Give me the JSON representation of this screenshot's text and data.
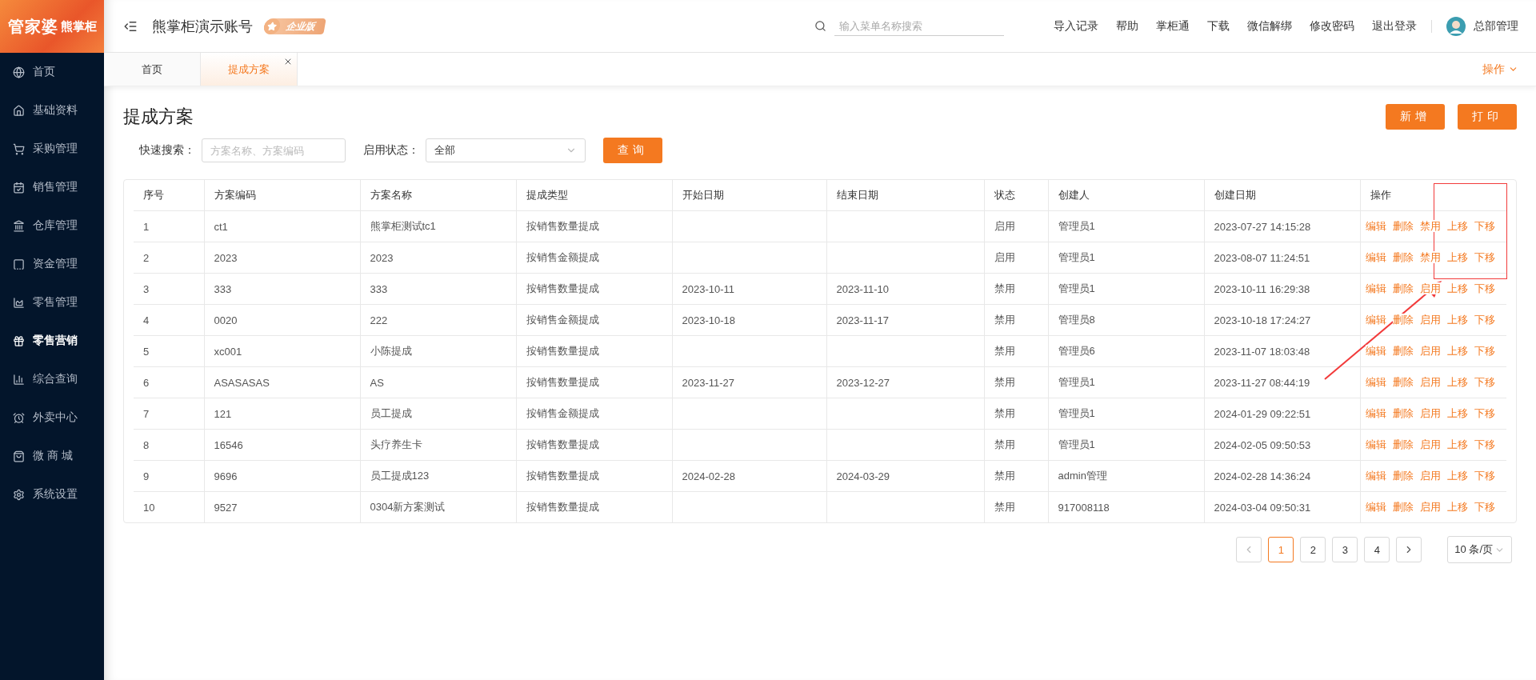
{
  "logo": {
    "brand": "管家婆",
    "product": "熊掌柜"
  },
  "sidebar": {
    "items": [
      {
        "label": "首页",
        "selected": false
      },
      {
        "label": "基础资料",
        "selected": false
      },
      {
        "label": "采购管理",
        "selected": false
      },
      {
        "label": "销售管理",
        "selected": false
      },
      {
        "label": "仓库管理",
        "selected": false
      },
      {
        "label": "资金管理",
        "selected": false
      },
      {
        "label": "零售管理",
        "selected": false
      },
      {
        "label": "零售营销",
        "selected": true
      },
      {
        "label": "综合查询",
        "selected": false
      },
      {
        "label": "外卖中心",
        "selected": false
      },
      {
        "label": "微 商 城",
        "selected": false
      },
      {
        "label": "系统设置",
        "selected": false
      }
    ]
  },
  "header": {
    "account": "熊掌柜演示账号",
    "edition": "企业版",
    "search": {
      "placeholder": "输入菜单名称搜索"
    },
    "links": [
      "导入记录",
      "帮助",
      "掌柜通",
      "下载",
      "微信解绑",
      "修改密码",
      "退出登录"
    ],
    "user": "总部管理"
  },
  "tabs": [
    {
      "label": "首页",
      "selected": false,
      "closable": false
    },
    {
      "label": "提成方案",
      "selected": true,
      "closable": true
    }
  ],
  "tab_menu": "操作",
  "page": {
    "title": "提成方案",
    "buttons": [
      "新增",
      "打印"
    ]
  },
  "filters": {
    "quick_search": {
      "label": "快速搜索：",
      "placeholder": "方案名称、方案编码"
    },
    "status": {
      "label": "启用状态：",
      "value": "全部"
    },
    "query_button": "查询"
  },
  "table": {
    "columns": [
      "序号",
      "方案编码",
      "方案名称",
      "提成类型",
      "开始日期",
      "结束日期",
      "状态",
      "创建人",
      "创建日期",
      "操作"
    ],
    "rows": [
      {
        "cells": [
          "1",
          "ct1",
          "熊掌柜测试tc1",
          "按销售数量提成",
          "",
          "",
          "启用",
          "管理员1",
          "2023-07-27 14:15:28"
        ],
        "actions": [
          "编辑",
          "删除",
          "禁用",
          "上移",
          "下移"
        ]
      },
      {
        "cells": [
          "2",
          "2023",
          "2023",
          "按销售金额提成",
          "",
          "",
          "启用",
          "管理员1",
          "2023-08-07 11:24:51"
        ],
        "actions": [
          "编辑",
          "删除",
          "禁用",
          "上移",
          "下移"
        ]
      },
      {
        "cells": [
          "3",
          "333",
          "333",
          "按销售数量提成",
          "2023-10-11",
          "2023-11-10",
          "禁用",
          "管理员1",
          "2023-10-11 16:29:38"
        ],
        "actions": [
          "编辑",
          "删除",
          "启用",
          "上移",
          "下移"
        ]
      },
      {
        "cells": [
          "4",
          "0020",
          "222",
          "按销售金额提成",
          "2023-10-18",
          "2023-11-17",
          "禁用",
          "管理员8",
          "2023-10-18 17:24:27"
        ],
        "actions": [
          "编辑",
          "删除",
          "启用",
          "上移",
          "下移"
        ]
      },
      {
        "cells": [
          "5",
          "xc001",
          "小陈提成",
          "按销售数量提成",
          "",
          "",
          "禁用",
          "管理员6",
          "2023-11-07 18:03:48"
        ],
        "actions": [
          "编辑",
          "删除",
          "启用",
          "上移",
          "下移"
        ]
      },
      {
        "cells": [
          "6",
          "ASASASAS",
          "AS",
          "按销售数量提成",
          "2023-11-27",
          "2023-12-27",
          "禁用",
          "管理员1",
          "2023-11-27 08:44:19"
        ],
        "actions": [
          "编辑",
          "删除",
          "启用",
          "上移",
          "下移"
        ]
      },
      {
        "cells": [
          "7",
          "121",
          "员工提成",
          "按销售金额提成",
          "",
          "",
          "禁用",
          "管理员1",
          "2024-01-29 09:22:51"
        ],
        "actions": [
          "编辑",
          "删除",
          "启用",
          "上移",
          "下移"
        ]
      },
      {
        "cells": [
          "8",
          "16546",
          "头疗养生卡",
          "按销售数量提成",
          "",
          "",
          "禁用",
          "管理员1",
          "2024-02-05 09:50:53"
        ],
        "actions": [
          "编辑",
          "删除",
          "启用",
          "上移",
          "下移"
        ]
      },
      {
        "cells": [
          "9",
          "9696",
          "员工提成123",
          "按销售数量提成",
          "2024-02-28",
          "2024-03-29",
          "禁用",
          "admin管理",
          "2024-02-28 14:36:24"
        ],
        "actions": [
          "编辑",
          "删除",
          "启用",
          "上移",
          "下移"
        ]
      },
      {
        "cells": [
          "10",
          "9527",
          "0304新方案测试",
          "按销售数量提成",
          "",
          "",
          "禁用",
          "917008118",
          "2024-03-04 09:50:31"
        ],
        "actions": [
          "编辑",
          "删除",
          "启用",
          "上移",
          "下移"
        ]
      }
    ]
  },
  "pagination": {
    "pages": [
      {
        "label": "1",
        "selected": true
      },
      {
        "label": "2",
        "selected": false
      },
      {
        "label": "3",
        "selected": false
      },
      {
        "label": "4",
        "selected": false
      }
    ],
    "page_size": "10 条/页"
  },
  "annotations": [
    {
      "kind": "box"
    },
    {
      "kind": "arrow"
    }
  ]
}
